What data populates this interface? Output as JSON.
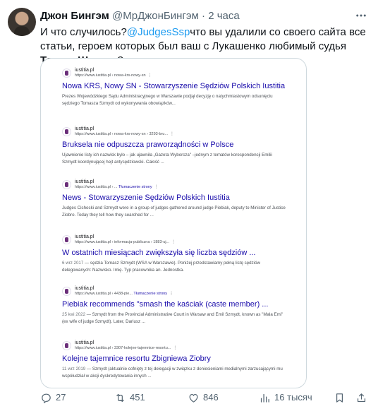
{
  "tweet": {
    "author_name": "Джон Бингэм",
    "handle": "@МрДжонБингэм",
    "separator": "·",
    "time": "2 часа",
    "text_before": "И что случилось?",
    "mention": "@JudgesSsp",
    "text_middle": "что вы удалили со своего сайта все статьи, героем которых был ваш с Лукашенко любимый судья ",
    "bold_name": "Томаш Шмидт",
    "text_after": " ?"
  },
  "search_results": [
    {
      "site": "iustitia.pl",
      "url": "https://www.iustitia.pl › nowa-krs-nowy-sn",
      "translate": "",
      "title": "Nowa KRS, Nowy SN - Stowarzyszenie Sędziów Polskich Iustitia",
      "snippet": "Prezes Wojewódzkiego Sądu Administracyjnego w Warszawie podjął decyzję o natychmiastowym odsunięciu sędziego Tomasza Szmydt od wykonywania obowiązków...",
      "date": ""
    },
    {
      "site": "iustitia.pl",
      "url": "https://www.iustitia.pl › nowa-krs-nowy-sn › 3293-bru...",
      "translate": "",
      "title": "Bruksela nie odpuszcza praworządności w Polsce",
      "snippet": "Ujawnienie listy ich nazwisk było – jak ujawniła „Gazeta Wyborcza\" –jednym z tematów korespondencji Emilii Szmydt koordynującej hejt antysędziowski. Całość ...",
      "date": ""
    },
    {
      "site": "iustitia.pl",
      "url": "https://www.iustitia.pl › ...",
      "translate": "Tłumaczenie strony",
      "title": "News - Stowarzyszenie Sędziów Polskich Iustitia",
      "snippet": "Judges Cichocki and Szmydt were in a group of judges gathered around judge Piebiak, deputy to Minister of Justice Ziobro. Today they tell how they searched for ...",
      "date": ""
    },
    {
      "site": "iustitia.pl",
      "url": "https://www.iustitia.pl › informacja-publiczna › 1883-uj...",
      "translate": "",
      "title": "W ostatnich miesiącach zwiększyła się liczba sędziów ...",
      "snippet": "— sędzia Tomasz Szmydt (WSA w Warszawie). Poniżej przedstawiamy pełną listę sędziów delegowanych: Nazwisko. Imię. Typ pracownika an. Jednostka.",
      "date": "6 wrz 2017"
    },
    {
      "site": "iustitia.pl",
      "url": "https://www.iustitia.pl › 4438-pie...",
      "translate": "Tłumaczenie strony",
      "title": "Piebiak recommends \"smash the kaściak (caste member) ...",
      "snippet": "— Szmydt from the Provincial Administrative Court in Warsaw and Emil Szmydt, known as \"Mala Emi\" (ex wife of judge Szmydt). Later, Dariusz ...",
      "date": "25 kwi 2022"
    },
    {
      "site": "iustitia.pl",
      "url": "https://www.iustitia.pl › 3307-kolejne-tajemnice-resortu...",
      "translate": "",
      "title": "Kolejne tajemnice resortu Zbigniewa Ziobry",
      "snippet": "— Szmydt (aktualnie cofnięty z tej delegacji w związku z doniesieniami medialnymi zarzucającymi mu współudział w akcji dyskredytowania innych ...",
      "date": "11 wrz 2019"
    }
  ],
  "actions": {
    "replies": "27",
    "retweets": "451",
    "likes": "846",
    "views": "16 тысяч"
  },
  "colors": {
    "link_blue": "#1d9bf0",
    "google_title": "#1a0dab",
    "meta_gray": "#536471"
  }
}
